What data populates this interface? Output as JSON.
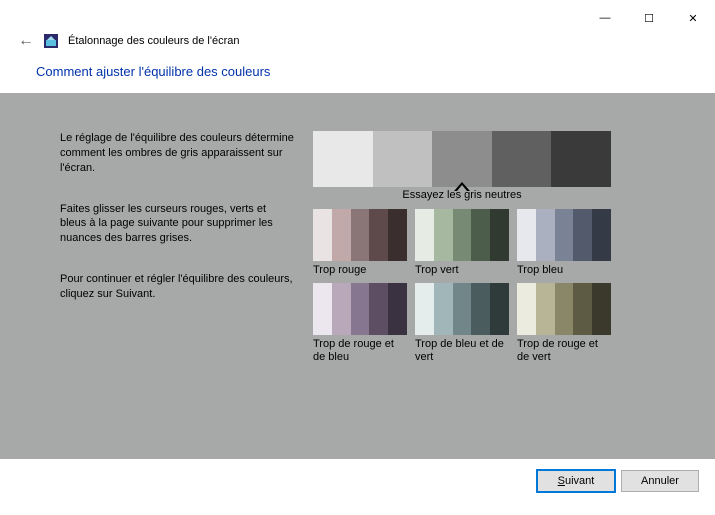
{
  "titlebar": {
    "minimize": "—",
    "maximize": "☐",
    "close": "✕"
  },
  "header": {
    "back_arrow": "←",
    "app_title": "Étalonnage des couleurs de l'écran"
  },
  "page_title": "Comment ajuster l'équilibre des couleurs",
  "left": {
    "p1": "Le réglage de l'équilibre des couleurs détermine comment les ombres de gris apparaissent sur l'écran.",
    "p2": "Faites glisser les curseurs rouges, verts et bleus à la page suivante pour supprimer les nuances des barres grises.",
    "p3": "Pour continuer et régler l'équilibre des couleurs, cliquez sur Suivant."
  },
  "right": {
    "neutral_caption": "Essayez les gris neutres",
    "neutral_colors": [
      "#e8e8e8",
      "#c0c0c0",
      "#8d8d8d",
      "#606060",
      "#3a3a3a"
    ],
    "swatches": [
      {
        "label": "Trop rouge",
        "colors": [
          "#eae3e3",
          "#c1a9a9",
          "#8a7676",
          "#5e4a4a",
          "#3a2e2e"
        ]
      },
      {
        "label": "Trop vert",
        "colors": [
          "#e6ece4",
          "#a7b8a0",
          "#778a73",
          "#4d5d4b",
          "#313a30"
        ]
      },
      {
        "label": "Trop bleu",
        "colors": [
          "#e6e8ee",
          "#aab0c0",
          "#7a8296",
          "#525a6c",
          "#343a46"
        ]
      },
      {
        "label": "Trop de rouge et de bleu",
        "colors": [
          "#ece6ee",
          "#b9a8ba",
          "#877690",
          "#5d4e64",
          "#3a3240"
        ]
      },
      {
        "label": "Trop de bleu et de vert",
        "colors": [
          "#e4ecec",
          "#a0b6b8",
          "#708688",
          "#4a5c5e",
          "#2f3a3b"
        ]
      },
      {
        "label": "Trop de rouge et de vert",
        "colors": [
          "#ecebe0",
          "#b8b496",
          "#898768",
          "#5d5b44",
          "#3a392c"
        ]
      }
    ]
  },
  "buttons": {
    "next_prefix": "S",
    "next_rest": "uivant",
    "cancel": "Annuler"
  }
}
